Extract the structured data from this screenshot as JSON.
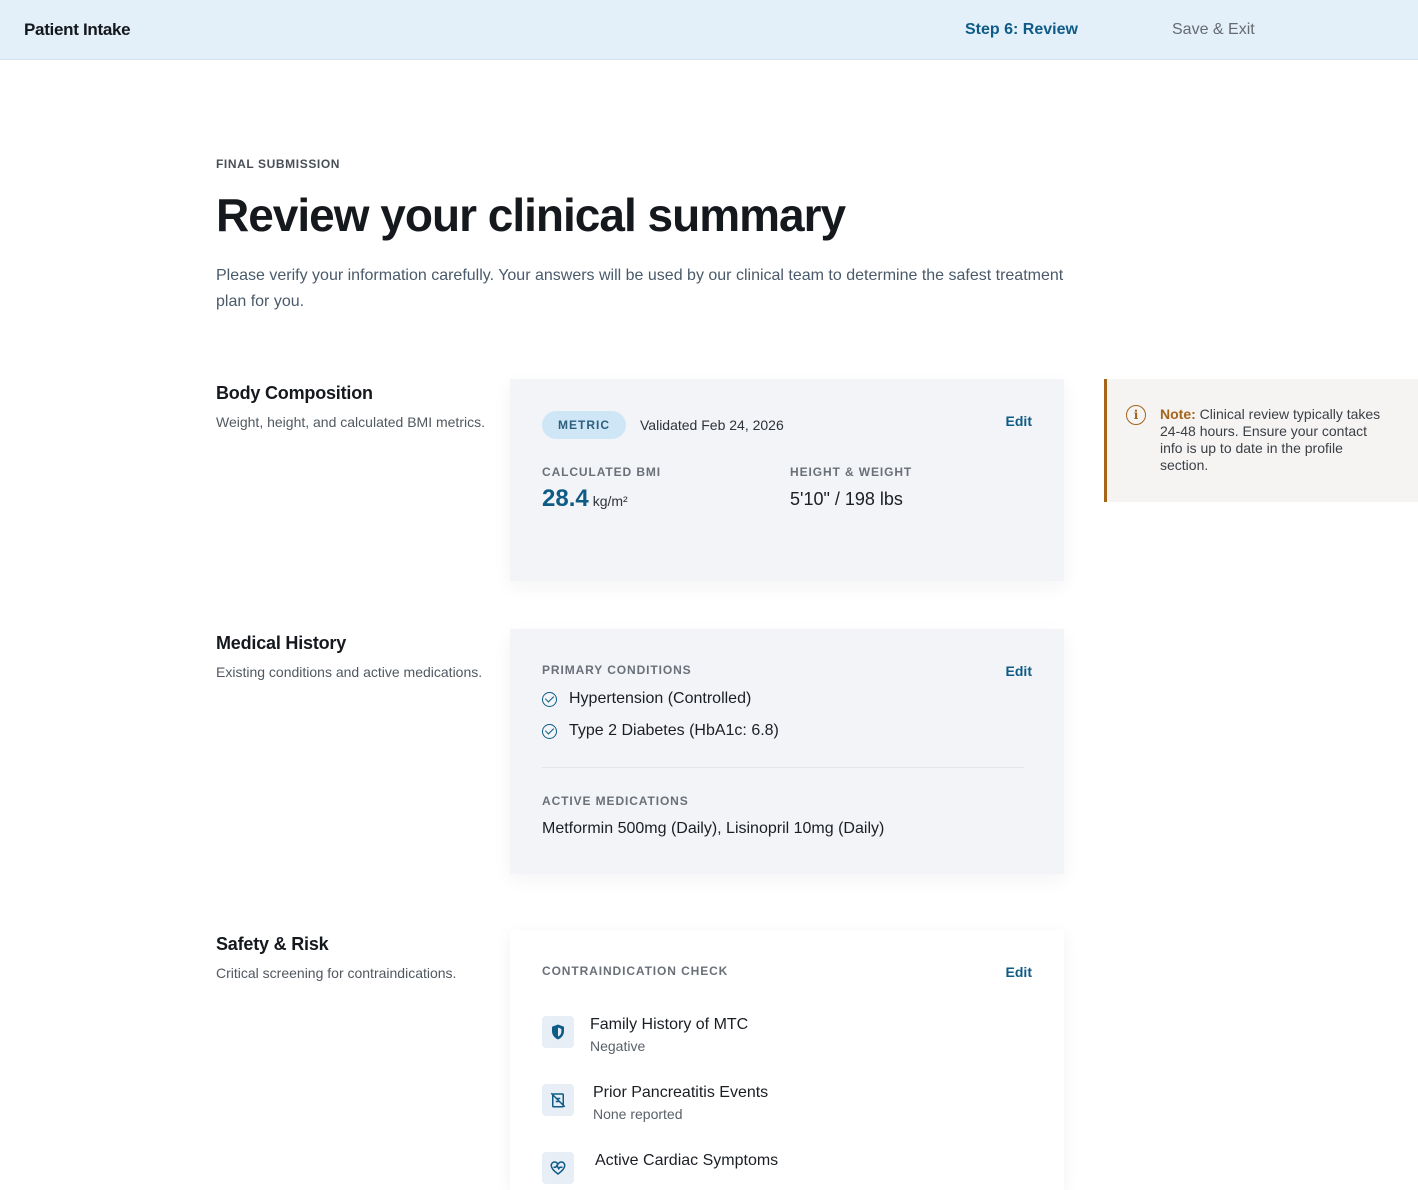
{
  "header": {
    "brand": "Patient Intake",
    "step": "Step 6: Review",
    "save_exit": "Save & Exit"
  },
  "page": {
    "eyebrow": "FINAL SUBMISSION",
    "title": "Review your clinical summary",
    "intro": "Please verify your information carefully. Your answers will be used by our clinical team to determine the safest treatment plan for you."
  },
  "body_composition": {
    "title": "Body Composition",
    "desc": "Weight, height, and calculated BMI metrics.",
    "badge": "METRIC",
    "validated": "Validated Feb 24, 2026",
    "edit": "Edit",
    "bmi_label": "CALCULATED BMI",
    "bmi_value": "28.4",
    "bmi_unit": "kg/m²",
    "hw_label": "HEIGHT & WEIGHT",
    "hw_value": "5'10\" / 198 lbs"
  },
  "medical_history": {
    "title": "Medical History",
    "desc": "Existing conditions and active medications.",
    "edit": "Edit",
    "conditions_label": "PRIMARY CONDITIONS",
    "conditions": [
      "Hypertension (Controlled)",
      "Type 2 Diabetes (HbA1c: 6.8)"
    ],
    "meds_label": "ACTIVE MEDICATIONS",
    "meds": "Metformin 500mg (Daily), Lisinopril 10mg (Daily)"
  },
  "safety": {
    "title": "Safety & Risk",
    "desc": "Critical screening for contraindications.",
    "edit": "Edit",
    "check_label": "CONTRAINDICATION CHECK",
    "items": [
      {
        "title": "Family History of MTC",
        "status": "Negative",
        "icon": "shield-icon"
      },
      {
        "title": "Prior Pancreatitis Events",
        "status": "None reported",
        "icon": "clipboard-icon"
      },
      {
        "title": "Active Cardiac Symptoms",
        "status": "",
        "icon": "heart-pulse-icon"
      }
    ]
  },
  "note": {
    "label": "Note:",
    "text": " Clinical review typically takes 24-48 hours. Ensure your contact info is up to date in the profile section."
  },
  "colors": {
    "accent": "#0e5c86",
    "topbar": "#e3eff9",
    "note_accent": "#a4651b"
  }
}
